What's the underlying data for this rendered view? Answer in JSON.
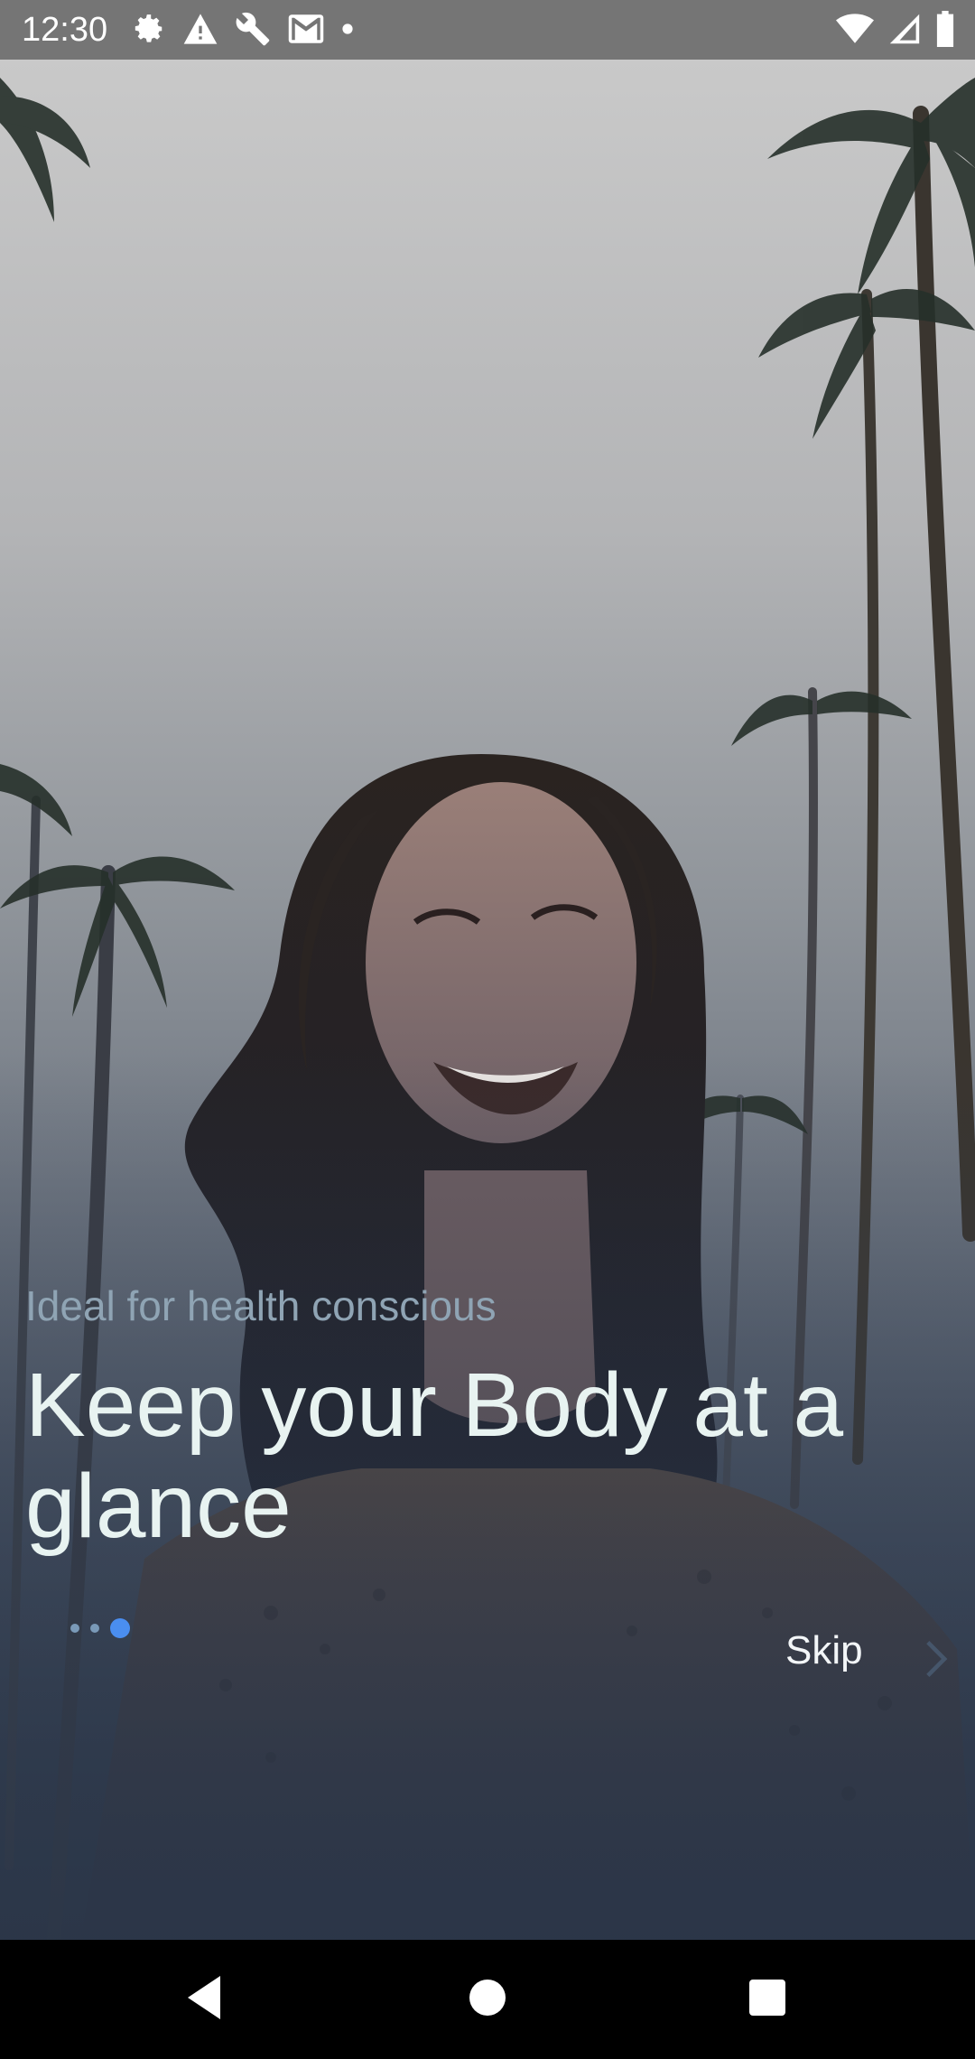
{
  "status_bar": {
    "time": "12:30",
    "left_icons": [
      "settings-icon",
      "warning-icon",
      "wrench-icon",
      "gmail-icon",
      "dot-icon"
    ],
    "right_icons": [
      "wifi-icon",
      "signal-icon",
      "battery-icon"
    ]
  },
  "onboarding": {
    "subtitle": "Ideal for health conscious",
    "title": "Keep your Body at a glance",
    "page_indicator": {
      "total": 3,
      "current": 3
    },
    "skip_label": "Skip",
    "next_icon": "chevron-right-icon",
    "accent_color": "#4a8ef0"
  },
  "nav_bar": {
    "buttons": [
      "back-icon",
      "home-icon",
      "recents-icon"
    ]
  }
}
